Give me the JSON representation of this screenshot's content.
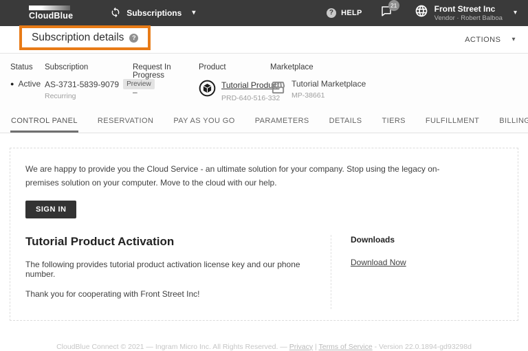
{
  "colors": {
    "header-bg": "#3a3a3a",
    "accent": "#e87b17",
    "button-bg": "#333333",
    "badge-bg": "#e3e3e3"
  },
  "icons": {
    "chevron_down": "▾",
    "status_dot": "●",
    "help_glyph": "?"
  },
  "header": {
    "logo_text": "CloudBlue",
    "nav": "Subscriptions",
    "help": "HELP",
    "notifications_count": "21",
    "account_name": "Front Street Inc",
    "account_subtitle": "Vendor · Robert Balboa"
  },
  "title_bar": {
    "title": "Subscription details",
    "actions": "ACTIONS"
  },
  "summary": {
    "status_label": "Status",
    "status_value": "Active",
    "subscription_label": "Subscription",
    "subscription_id": "AS-3731-5839-9079",
    "subscription_badge": "Preview",
    "subscription_type": "Recurring",
    "request_label": "Request In Progress",
    "request_value": "–",
    "product_label": "Product",
    "product_name": "Tutorial Product",
    "product_id": "PRD-640-516-332",
    "marketplace_label": "Marketplace",
    "marketplace_name": "Tutorial Marketplace",
    "marketplace_id": "MP-38661"
  },
  "tabs": [
    {
      "label": "CONTROL PANEL",
      "active": true
    },
    {
      "label": "RESERVATION",
      "active": false
    },
    {
      "label": "PAY AS YOU GO",
      "active": false
    },
    {
      "label": "PARAMETERS",
      "active": false
    },
    {
      "label": "DETAILS",
      "active": false
    },
    {
      "label": "TIERS",
      "active": false
    },
    {
      "label": "FULFILLMENT",
      "active": false
    },
    {
      "label": "BILLING",
      "active": false
    }
  ],
  "panel": {
    "welcome": "We are happy to provide you the Cloud Service - an ultimate solution for your company. Stop using the legacy on-premises solution on your computer. Move to the cloud with our help.",
    "sign_in": "SIGN IN",
    "section_title": "Tutorial Product Activation",
    "paragraph1": "The following provides tutorial product activation license key and our phone number.",
    "paragraph2": "Thank you for cooperating with Front Street Inc!",
    "downloads_label": "Downloads",
    "download_link": "Download Now"
  },
  "footer": {
    "part1": "CloudBlue Connect © 2021 — Ingram Micro Inc. All Rights Reserved. — ",
    "privacy": "Privacy",
    "sep": " | ",
    "terms": "Terms of Service",
    "part2": " - Version 22.0.1894-gd93298d"
  }
}
